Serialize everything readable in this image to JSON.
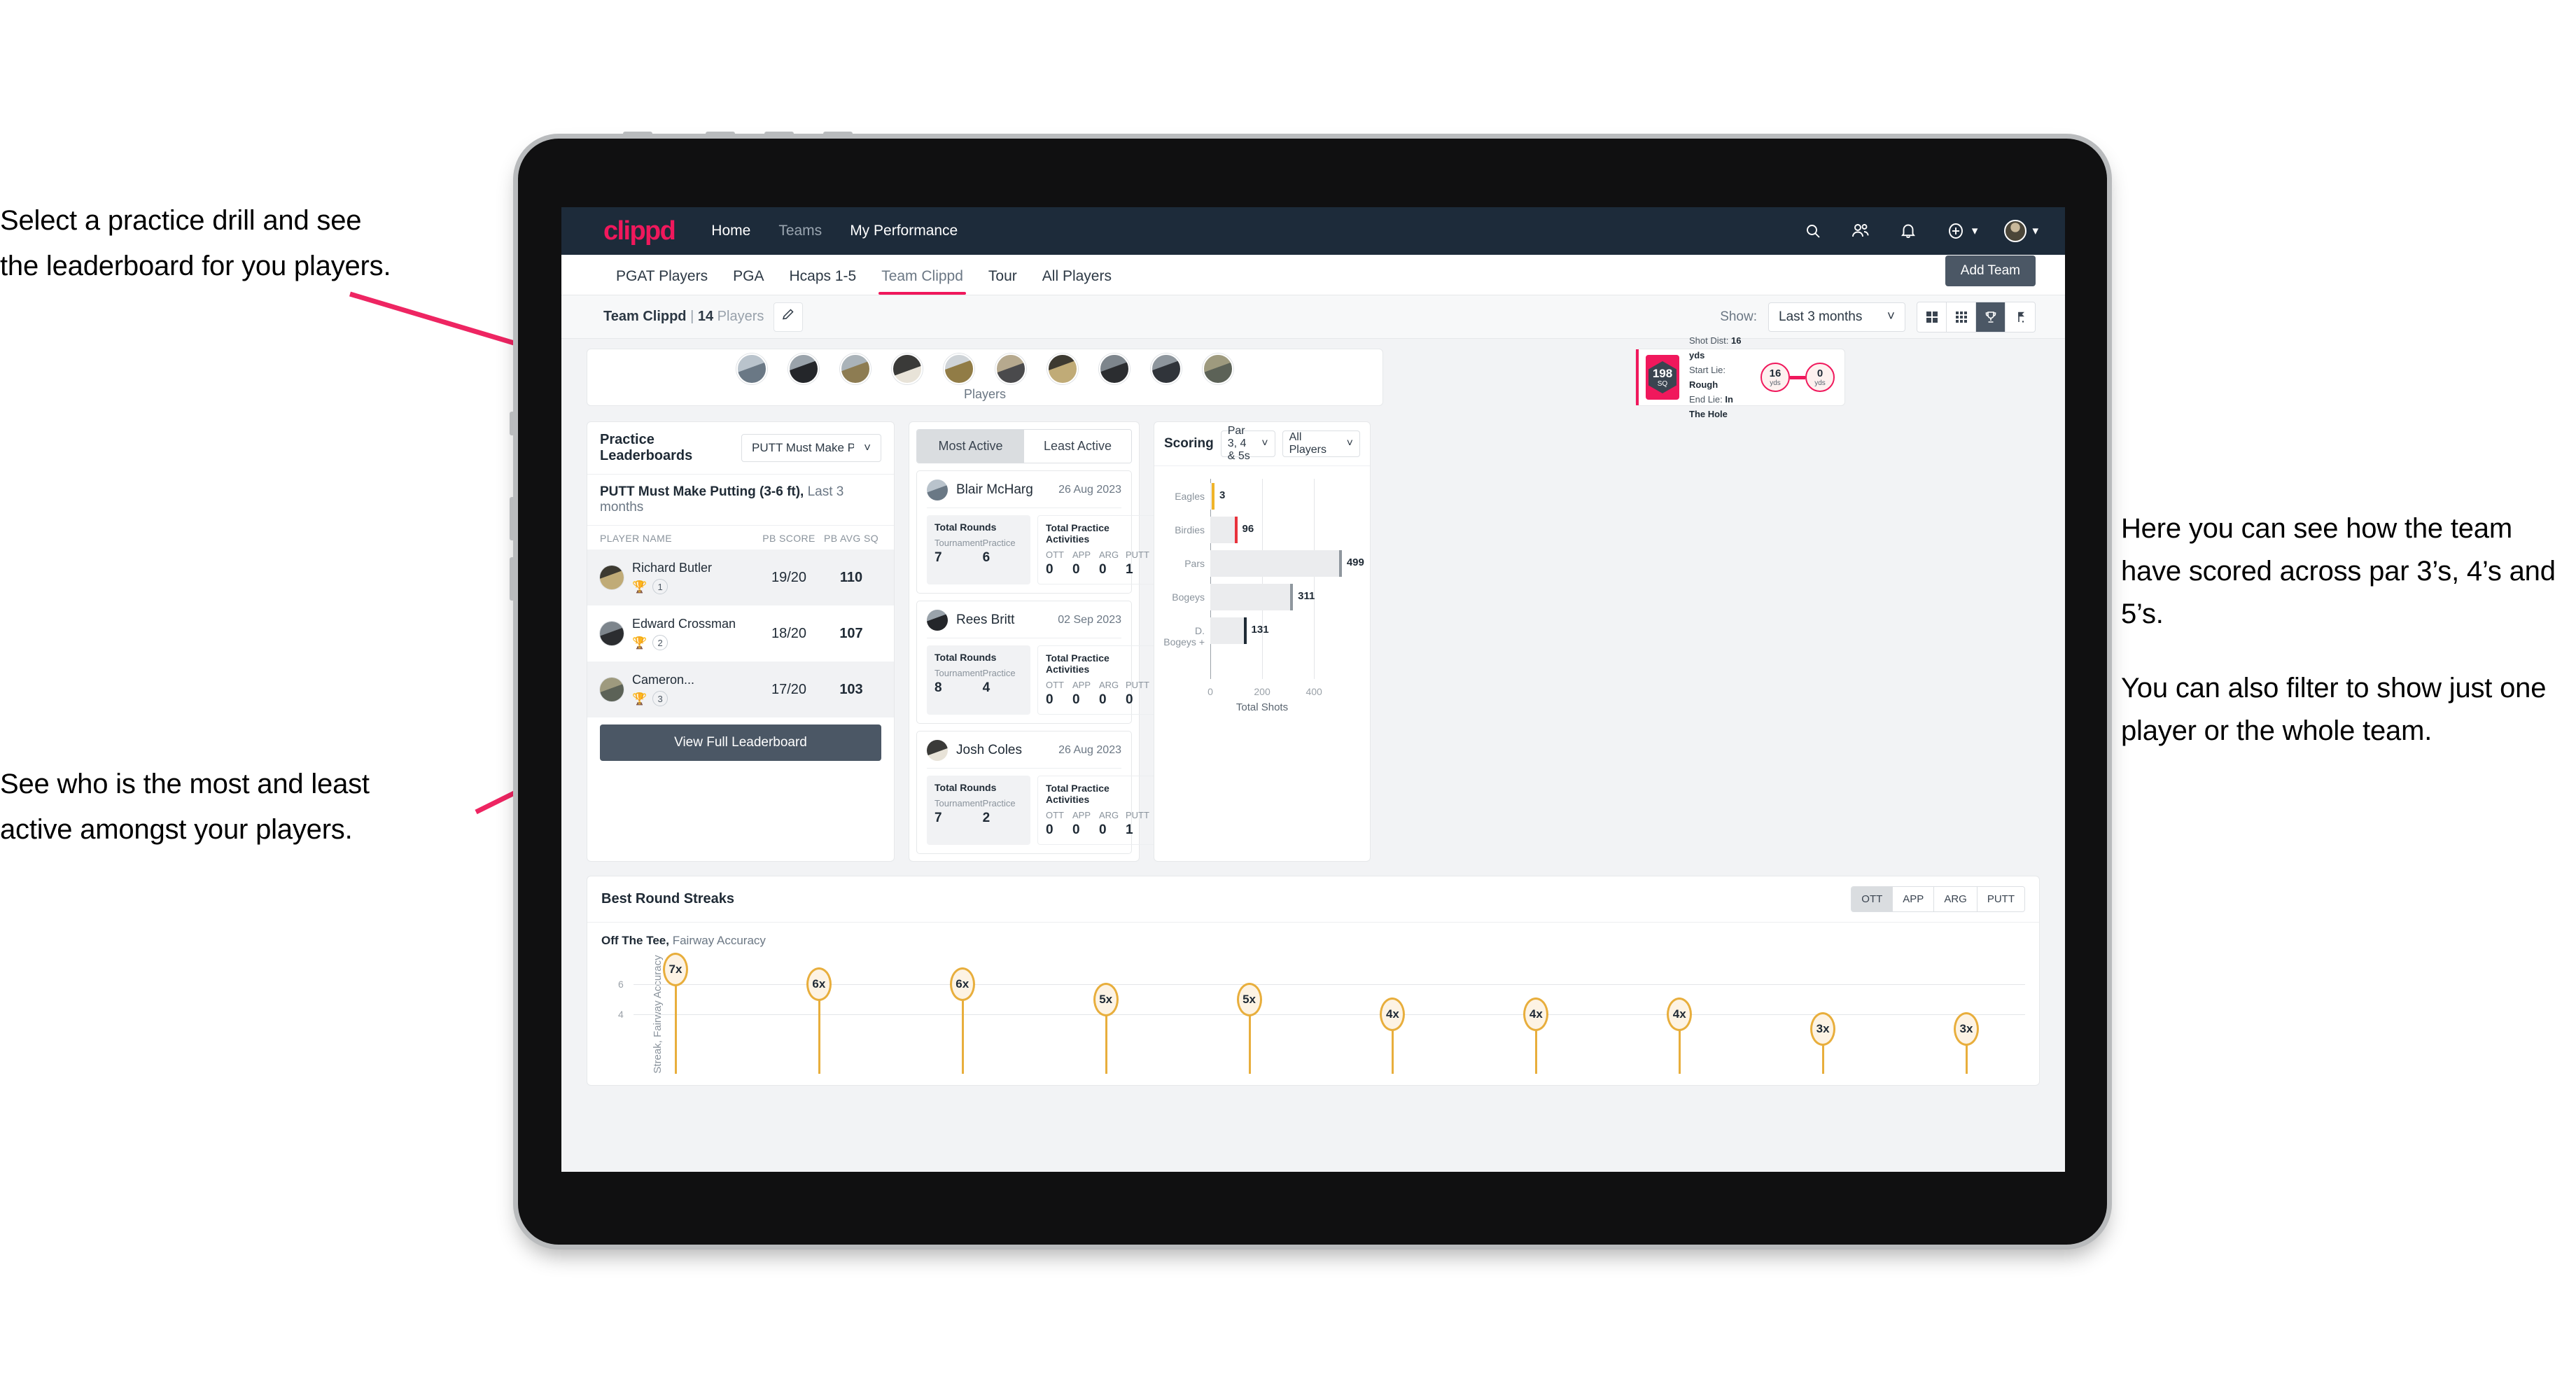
{
  "annotations": {
    "left_top": [
      "Select a practice drill and see",
      "the leaderboard for you players."
    ],
    "left_bottom": [
      "See who is the most and least",
      "active amongst your players."
    ],
    "right": [
      "Here you can see how the team have scored across par 3’s, 4’s and 5’s.",
      "You can also filter to show just one player or the whole team."
    ],
    "arrow_color": "#ee2562"
  },
  "app": {
    "brand": "clippd",
    "brand_color": "#f0185c",
    "nav_links": [
      {
        "label": "Home",
        "active": true
      },
      {
        "label": "Teams",
        "active": false
      },
      {
        "label": "My Performance",
        "active": true
      }
    ],
    "nav_icons": [
      "search-icon",
      "people-icon",
      "bell-icon",
      "plus-circle-icon",
      "avatar"
    ],
    "tabs": [
      {
        "label": "PGAT Players",
        "active": false
      },
      {
        "label": "PGA",
        "active": false
      },
      {
        "label": "Hcaps 1-5",
        "active": false
      },
      {
        "label": "Team Clippd",
        "active": true
      },
      {
        "label": "Tour",
        "active": false
      },
      {
        "label": "All Players",
        "active": false
      }
    ],
    "add_team_button": "Add Team"
  },
  "filter_bar": {
    "team_name": "Team Clippd",
    "separator": "|",
    "player_count": "14",
    "players_word": "Players",
    "edit_icon": "pencil-icon",
    "show_label": "Show:",
    "date_range": "Last 3 months",
    "view_toggles": [
      {
        "icon": "grid-4-icon",
        "active": false
      },
      {
        "icon": "grid-9-icon",
        "active": false
      },
      {
        "icon": "trophy-icon",
        "active": true
      },
      {
        "icon": "flag-icon",
        "active": false
      }
    ]
  },
  "players_strip": {
    "label": "Players",
    "count": 10
  },
  "shot_card": {
    "sq_value": "198",
    "sq_label": "SQ",
    "shot_dist_label": "Shot Dist:",
    "shot_dist_value": "16 yds",
    "start_lie_label": "Start Lie:",
    "start_lie_value": "Rough",
    "end_lie_label": "End Lie:",
    "end_lie_value": "In The Hole",
    "from_value": "16",
    "from_unit": "yds",
    "to_value": "0",
    "to_unit": "yds"
  },
  "practice_leaderboards": {
    "title": "Practice Leaderboards",
    "drill_select": "PUTT Must Make Putting ...",
    "subtitle_bold": "PUTT Must Make Putting (3-6 ft),",
    "subtitle_rest": "Last 3 months",
    "columns": [
      "PLAYER NAME",
      "PB SCORE",
      "PB AVG SQ"
    ],
    "rows": [
      {
        "name": "Richard Butler",
        "rank": "1",
        "trophy": "gold",
        "pb_score": "19/20",
        "pb_avg_sq": "110"
      },
      {
        "name": "Edward Crossman",
        "rank": "2",
        "trophy": "silver",
        "pb_score": "18/20",
        "pb_avg_sq": "107"
      },
      {
        "name": "Cameron...",
        "rank": "3",
        "trophy": "bronze",
        "pb_score": "17/20",
        "pb_avg_sq": "103"
      }
    ],
    "button": "View Full Leaderboard"
  },
  "activity": {
    "tabs": [
      {
        "label": "Most Active",
        "active": true
      },
      {
        "label": "Least Active",
        "active": false
      }
    ],
    "rounds_title": "Total Rounds",
    "rounds_keys": [
      "Tournament",
      "Practice"
    ],
    "acts_title": "Total Practice Activities",
    "acts_keys": [
      "OTT",
      "APP",
      "ARG",
      "PUTT"
    ],
    "players": [
      {
        "name": "Blair McHarg",
        "date": "26 Aug 2023",
        "tournament": "7",
        "practice": "6",
        "ott": "0",
        "app": "0",
        "arg": "0",
        "putt": "1"
      },
      {
        "name": "Rees Britt",
        "date": "02 Sep 2023",
        "tournament": "8",
        "practice": "4",
        "ott": "0",
        "app": "0",
        "arg": "0",
        "putt": "0"
      },
      {
        "name": "Josh Coles",
        "date": "26 Aug 2023",
        "tournament": "7",
        "practice": "2",
        "ott": "0",
        "app": "0",
        "arg": "0",
        "putt": "1"
      }
    ]
  },
  "scoring": {
    "title": "Scoring",
    "par_select": "Par 3, 4 & 5s",
    "player_select": "All Players"
  },
  "best_round_streaks": {
    "title": "Best Round Streaks",
    "segments": [
      {
        "label": "OTT",
        "active": true
      },
      {
        "label": "APP",
        "active": false
      },
      {
        "label": "ARG",
        "active": false
      },
      {
        "label": "PUTT",
        "active": false
      }
    ],
    "sub_bold": "Off The Tee,",
    "sub_rest": "Fairway Accuracy"
  },
  "chart_data": [
    {
      "type": "bar",
      "orientation": "horizontal",
      "title": "Scoring",
      "categories": [
        "Eagles",
        "Birdies",
        "Pars",
        "Bogeys",
        "D. Bogeys +"
      ],
      "values": [
        3,
        96,
        499,
        311,
        131
      ],
      "cap_colors": [
        "#f0b429",
        "#e8323c",
        "#8f979e",
        "#8f979e",
        "#1f2a35"
      ],
      "xlabel": "Total Shots",
      "ylabel": "",
      "xlim": [
        0,
        540
      ],
      "xticks": [
        0,
        200,
        400
      ],
      "grid": true,
      "legend": "none"
    },
    {
      "type": "bar",
      "orientation": "vertical",
      "title": "Best Round Streaks",
      "subtitle": "Off The Tee, Fairway Accuracy",
      "categories": [
        "1",
        "2",
        "3",
        "4",
        "5",
        "6",
        "7",
        "8",
        "9",
        "10"
      ],
      "values": [
        7,
        6,
        6,
        5,
        5,
        4,
        4,
        4,
        3,
        3
      ],
      "labels": [
        "7x",
        "6x",
        "6x",
        "5x",
        "5x",
        "4x",
        "4x",
        "4x",
        "3x",
        "3x"
      ],
      "ylabel": "Streak, Fairway Accuracy",
      "yticks": [
        4,
        6
      ],
      "ylim": [
        0,
        7.8
      ],
      "series_color": "#e8ae3c",
      "grid": true,
      "legend": "none"
    }
  ]
}
